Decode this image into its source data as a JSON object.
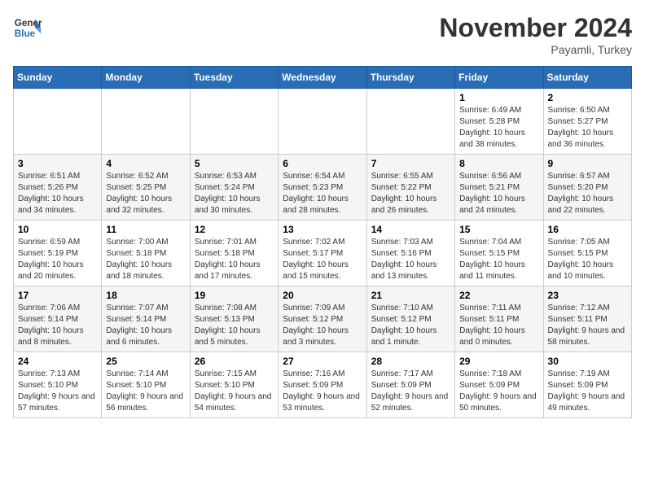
{
  "header": {
    "logo_line1": "General",
    "logo_line2": "Blue",
    "month": "November 2024",
    "location": "Payamli, Turkey"
  },
  "weekdays": [
    "Sunday",
    "Monday",
    "Tuesday",
    "Wednesday",
    "Thursday",
    "Friday",
    "Saturday"
  ],
  "weeks": [
    [
      {
        "day": "",
        "sunrise": "",
        "sunset": "",
        "daylight": ""
      },
      {
        "day": "",
        "sunrise": "",
        "sunset": "",
        "daylight": ""
      },
      {
        "day": "",
        "sunrise": "",
        "sunset": "",
        "daylight": ""
      },
      {
        "day": "",
        "sunrise": "",
        "sunset": "",
        "daylight": ""
      },
      {
        "day": "",
        "sunrise": "",
        "sunset": "",
        "daylight": ""
      },
      {
        "day": "1",
        "sunrise": "Sunrise: 6:49 AM",
        "sunset": "Sunset: 5:28 PM",
        "daylight": "Daylight: 10 hours and 38 minutes."
      },
      {
        "day": "2",
        "sunrise": "Sunrise: 6:50 AM",
        "sunset": "Sunset: 5:27 PM",
        "daylight": "Daylight: 10 hours and 36 minutes."
      }
    ],
    [
      {
        "day": "3",
        "sunrise": "Sunrise: 6:51 AM",
        "sunset": "Sunset: 5:26 PM",
        "daylight": "Daylight: 10 hours and 34 minutes."
      },
      {
        "day": "4",
        "sunrise": "Sunrise: 6:52 AM",
        "sunset": "Sunset: 5:25 PM",
        "daylight": "Daylight: 10 hours and 32 minutes."
      },
      {
        "day": "5",
        "sunrise": "Sunrise: 6:53 AM",
        "sunset": "Sunset: 5:24 PM",
        "daylight": "Daylight: 10 hours and 30 minutes."
      },
      {
        "day": "6",
        "sunrise": "Sunrise: 6:54 AM",
        "sunset": "Sunset: 5:23 PM",
        "daylight": "Daylight: 10 hours and 28 minutes."
      },
      {
        "day": "7",
        "sunrise": "Sunrise: 6:55 AM",
        "sunset": "Sunset: 5:22 PM",
        "daylight": "Daylight: 10 hours and 26 minutes."
      },
      {
        "day": "8",
        "sunrise": "Sunrise: 6:56 AM",
        "sunset": "Sunset: 5:21 PM",
        "daylight": "Daylight: 10 hours and 24 minutes."
      },
      {
        "day": "9",
        "sunrise": "Sunrise: 6:57 AM",
        "sunset": "Sunset: 5:20 PM",
        "daylight": "Daylight: 10 hours and 22 minutes."
      }
    ],
    [
      {
        "day": "10",
        "sunrise": "Sunrise: 6:59 AM",
        "sunset": "Sunset: 5:19 PM",
        "daylight": "Daylight: 10 hours and 20 minutes."
      },
      {
        "day": "11",
        "sunrise": "Sunrise: 7:00 AM",
        "sunset": "Sunset: 5:18 PM",
        "daylight": "Daylight: 10 hours and 18 minutes."
      },
      {
        "day": "12",
        "sunrise": "Sunrise: 7:01 AM",
        "sunset": "Sunset: 5:18 PM",
        "daylight": "Daylight: 10 hours and 17 minutes."
      },
      {
        "day": "13",
        "sunrise": "Sunrise: 7:02 AM",
        "sunset": "Sunset: 5:17 PM",
        "daylight": "Daylight: 10 hours and 15 minutes."
      },
      {
        "day": "14",
        "sunrise": "Sunrise: 7:03 AM",
        "sunset": "Sunset: 5:16 PM",
        "daylight": "Daylight: 10 hours and 13 minutes."
      },
      {
        "day": "15",
        "sunrise": "Sunrise: 7:04 AM",
        "sunset": "Sunset: 5:15 PM",
        "daylight": "Daylight: 10 hours and 11 minutes."
      },
      {
        "day": "16",
        "sunrise": "Sunrise: 7:05 AM",
        "sunset": "Sunset: 5:15 PM",
        "daylight": "Daylight: 10 hours and 10 minutes."
      }
    ],
    [
      {
        "day": "17",
        "sunrise": "Sunrise: 7:06 AM",
        "sunset": "Sunset: 5:14 PM",
        "daylight": "Daylight: 10 hours and 8 minutes."
      },
      {
        "day": "18",
        "sunrise": "Sunrise: 7:07 AM",
        "sunset": "Sunset: 5:14 PM",
        "daylight": "Daylight: 10 hours and 6 minutes."
      },
      {
        "day": "19",
        "sunrise": "Sunrise: 7:08 AM",
        "sunset": "Sunset: 5:13 PM",
        "daylight": "Daylight: 10 hours and 5 minutes."
      },
      {
        "day": "20",
        "sunrise": "Sunrise: 7:09 AM",
        "sunset": "Sunset: 5:12 PM",
        "daylight": "Daylight: 10 hours and 3 minutes."
      },
      {
        "day": "21",
        "sunrise": "Sunrise: 7:10 AM",
        "sunset": "Sunset: 5:12 PM",
        "daylight": "Daylight: 10 hours and 1 minute."
      },
      {
        "day": "22",
        "sunrise": "Sunrise: 7:11 AM",
        "sunset": "Sunset: 5:11 PM",
        "daylight": "Daylight: 10 hours and 0 minutes."
      },
      {
        "day": "23",
        "sunrise": "Sunrise: 7:12 AM",
        "sunset": "Sunset: 5:11 PM",
        "daylight": "Daylight: 9 hours and 58 minutes."
      }
    ],
    [
      {
        "day": "24",
        "sunrise": "Sunrise: 7:13 AM",
        "sunset": "Sunset: 5:10 PM",
        "daylight": "Daylight: 9 hours and 57 minutes."
      },
      {
        "day": "25",
        "sunrise": "Sunrise: 7:14 AM",
        "sunset": "Sunset: 5:10 PM",
        "daylight": "Daylight: 9 hours and 56 minutes."
      },
      {
        "day": "26",
        "sunrise": "Sunrise: 7:15 AM",
        "sunset": "Sunset: 5:10 PM",
        "daylight": "Daylight: 9 hours and 54 minutes."
      },
      {
        "day": "27",
        "sunrise": "Sunrise: 7:16 AM",
        "sunset": "Sunset: 5:09 PM",
        "daylight": "Daylight: 9 hours and 53 minutes."
      },
      {
        "day": "28",
        "sunrise": "Sunrise: 7:17 AM",
        "sunset": "Sunset: 5:09 PM",
        "daylight": "Daylight: 9 hours and 52 minutes."
      },
      {
        "day": "29",
        "sunrise": "Sunrise: 7:18 AM",
        "sunset": "Sunset: 5:09 PM",
        "daylight": "Daylight: 9 hours and 50 minutes."
      },
      {
        "day": "30",
        "sunrise": "Sunrise: 7:19 AM",
        "sunset": "Sunset: 5:09 PM",
        "daylight": "Daylight: 9 hours and 49 minutes."
      }
    ]
  ]
}
